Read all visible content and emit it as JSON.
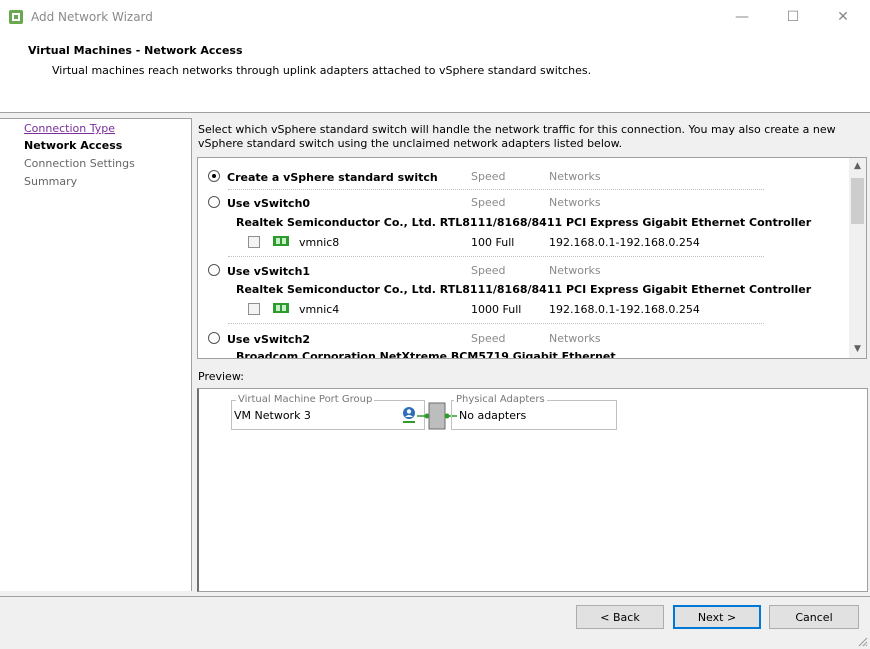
{
  "window": {
    "title": "Add Network Wizard",
    "minimize": "—",
    "maximize": "☐",
    "close": "✕"
  },
  "header": {
    "title": "Virtual Machines - Network Access",
    "subtitle": "Virtual machines reach networks through uplink adapters attached to vSphere standard switches."
  },
  "steps": [
    {
      "label": "Connection Type",
      "state": "link"
    },
    {
      "label": "Network Access",
      "state": "current"
    },
    {
      "label": "Connection Settings",
      "state": "disabled"
    },
    {
      "label": "Summary",
      "state": "disabled"
    }
  ],
  "instructions": "Select which vSphere standard switch will handle the network traffic for this connection. You may also create a new vSphere standard switch using the unclaimed network adapters listed below.",
  "switch_list": {
    "speed_header": "Speed",
    "networks_header": "Networks",
    "options": [
      {
        "label": "Create a vSphere standard switch",
        "selected": true
      },
      {
        "label": "Use vSwitch0",
        "selected": false,
        "controller": "Realtek Semiconductor Co., Ltd. RTL8111/8168/8411 PCI Express Gigabit Ethernet Controller",
        "nic": {
          "name": "vmnic8",
          "speed": "100 Full",
          "networks": "192.168.0.1-192.168.0.254",
          "checked": false
        }
      },
      {
        "label": "Use vSwitch1",
        "selected": false,
        "controller": "Realtek Semiconductor Co., Ltd. RTL8111/8168/8411 PCI Express Gigabit Ethernet Controller",
        "nic": {
          "name": "vmnic4",
          "speed": "1000 Full",
          "networks": "192.168.0.1-192.168.0.254",
          "checked": false
        }
      },
      {
        "label": "Use vSwitch2",
        "selected": false,
        "controller": "Broadcom Corporation NetXtreme BCM5719 Gigabit Ethernet"
      }
    ]
  },
  "preview": {
    "label": "Preview:",
    "port_group_legend": "Virtual Machine Port Group",
    "port_group_name": "VM Network 3",
    "adapters_legend": "Physical Adapters",
    "adapters_value": "No adapters"
  },
  "buttons": {
    "back": "< Back",
    "next": "Next >",
    "cancel": "Cancel"
  },
  "colors": {
    "link": "#7a2f9c",
    "accent": "#0078d7",
    "nic_green": "#2e9b2e"
  }
}
